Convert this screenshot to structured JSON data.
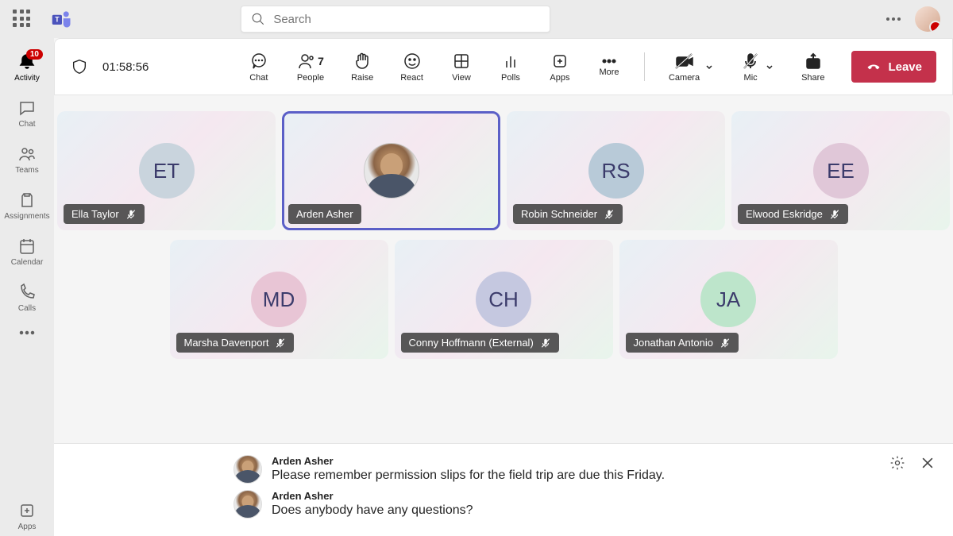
{
  "search": {
    "placeholder": "Search"
  },
  "rail": {
    "activity": {
      "label": "Activity",
      "badge": "10"
    },
    "chat": {
      "label": "Chat"
    },
    "teams": {
      "label": "Teams"
    },
    "assignments": {
      "label": "Assignments"
    },
    "calendar": {
      "label": "Calendar"
    },
    "calls": {
      "label": "Calls"
    },
    "apps": {
      "label": "Apps"
    }
  },
  "meeting": {
    "timer": "01:58:56",
    "toolbar": {
      "chat": "Chat",
      "people": "People",
      "people_count": "7",
      "raise": "Raise",
      "react": "React",
      "view": "View",
      "polls": "Polls",
      "apps": "Apps",
      "more": "More",
      "camera": "Camera",
      "mic": "Mic",
      "share": "Share",
      "leave": "Leave"
    }
  },
  "participants": {
    "row1": [
      {
        "initials": "ET",
        "name": "Ella Taylor",
        "muted": true,
        "avatar_bg": "#c9d4dd",
        "speaking": false,
        "photo": false
      },
      {
        "initials": "",
        "name": "Arden Asher",
        "muted": false,
        "avatar_bg": "",
        "speaking": true,
        "photo": true
      },
      {
        "initials": "RS",
        "name": "Robin Schneider",
        "muted": true,
        "avatar_bg": "#b8cad8",
        "speaking": false,
        "photo": false
      },
      {
        "initials": "EE",
        "name": "Elwood Eskridge",
        "muted": true,
        "avatar_bg": "#e0c7d8",
        "speaking": false,
        "photo": false
      }
    ],
    "row2": [
      {
        "initials": "MD",
        "name": "Marsha Davenport",
        "muted": true,
        "avatar_bg": "#e8c5d5",
        "speaking": false,
        "photo": false
      },
      {
        "initials": "CH",
        "name": "Conny Hoffmann (External)",
        "muted": true,
        "avatar_bg": "#c5c8e0",
        "speaking": false,
        "photo": false
      },
      {
        "initials": "JA",
        "name": "Jonathan Antonio",
        "muted": true,
        "avatar_bg": "#bde5cb",
        "speaking": false,
        "photo": false
      }
    ]
  },
  "chat": [
    {
      "sender": "Arden Asher",
      "text": "Please remember permission slips for the field trip are due this Friday."
    },
    {
      "sender": "Arden Asher",
      "text": "Does anybody have any questions?"
    }
  ]
}
